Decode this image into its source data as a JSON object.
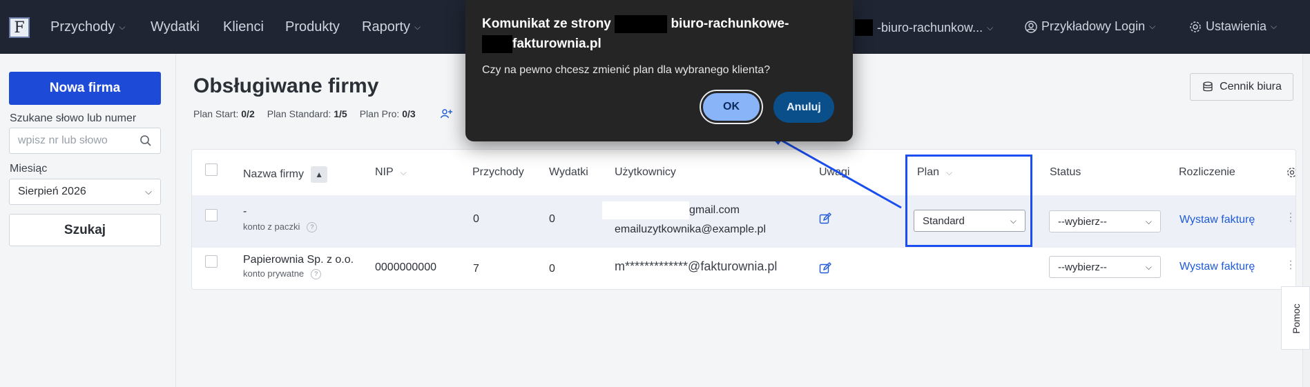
{
  "nav": {
    "logo_letter": "F",
    "items": [
      "Przychody",
      "Wydatki",
      "Klienci",
      "Produkty",
      "Raporty"
    ],
    "account": "-biuro-rachunkow...",
    "login": "Przykładowy Login",
    "settings": "Ustawienia"
  },
  "sidebar": {
    "new_firm_label": "Nowa firma",
    "search_label": "Szukane słowo lub numer",
    "search_placeholder": "wpisz nr lub słowo",
    "month_label": "Miesiąc",
    "month_value": "Sierpień 2026",
    "search_button": "Szukaj"
  },
  "main": {
    "title": "Obsługiwane firmy",
    "plan_start_label": "Plan Start:",
    "plan_start_value": "0/2",
    "plan_standard_label": "Plan Standard:",
    "plan_standard_value": "1/5",
    "plan_pro_label": "Plan Pro:",
    "plan_pro_value": "0/3",
    "cennik_label": "Cennik biura"
  },
  "table": {
    "headers": {
      "name": "Nazwa firmy",
      "nip": "NIP",
      "income": "Przychody",
      "expenses": "Wydatki",
      "users": "Użytkownicy",
      "notes": "Uwagi",
      "plan": "Plan",
      "status": "Status",
      "billing": "Rozliczenie"
    },
    "rows": [
      {
        "name": "-",
        "subtitle": "konto z paczki",
        "nip": "",
        "income": "0",
        "expenses": "0",
        "user1": "gmail.com",
        "user2": "emailuzytkownika@example.pl",
        "plan": "Standard",
        "status": "--wybierz--",
        "billing": "Wystaw fakturę"
      },
      {
        "name": "Papierownia Sp. z o.o.",
        "subtitle": "konto prywatne",
        "nip": "0000000000",
        "income": "7",
        "expenses": "0",
        "user1": "m*************@fakturownia.pl",
        "user2": "",
        "plan": "",
        "status": "--wybierz--",
        "billing": "Wystaw fakturę"
      }
    ]
  },
  "dialog": {
    "title_prefix": "Komunikat ze strony",
    "title_mid": "biuro-rachunkowe-",
    "title_end": "fakturownia.pl",
    "message": "Czy na pewno chcesz zmienić plan dla wybranego klienta?",
    "ok": "OK",
    "cancel": "Anuluj"
  },
  "help": "Pomoc",
  "colors": {
    "nav_bg": "#1f2533",
    "primary": "#1e4ad8",
    "dialog_bg": "#252526",
    "ok_bg": "#8ab4f8",
    "cancel_bg": "#0b4f8a",
    "highlight": "#1a4ef0"
  }
}
